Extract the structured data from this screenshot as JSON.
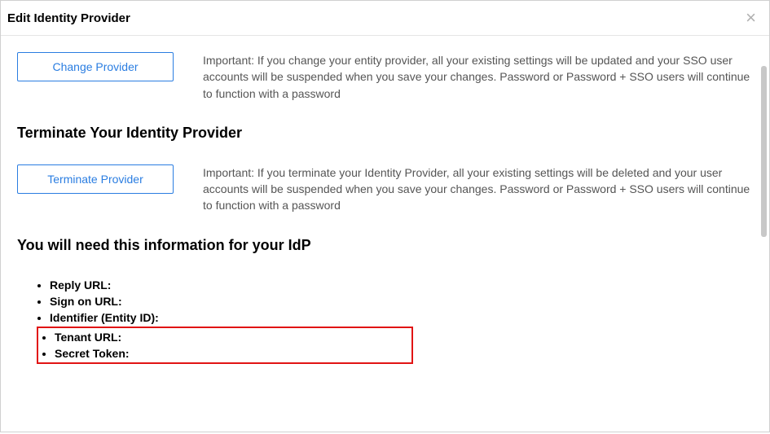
{
  "header": {
    "title": "Edit Identity Provider"
  },
  "changeProvider": {
    "buttonLabel": "Change Provider",
    "notice": "Important: If you change your entity provider, all your existing settings will be updated and your SSO user accounts will be suspended when you save your changes. Password or Password + SSO users will continue to function with a password"
  },
  "terminate": {
    "heading": "Terminate Your Identity Provider",
    "buttonLabel": "Terminate Provider",
    "notice": "Important: If you terminate your Identity Provider, all your existing settings will be deleted and your user accounts will be suspended when you save your changes. Password or Password + SSO users will continue to function with a password"
  },
  "idpInfo": {
    "heading": "You will need this information for your IdP",
    "items": {
      "replyUrl": "Reply URL:",
      "signOnUrl": "Sign on URL:",
      "identifier": "Identifier (Entity ID):",
      "tenantUrl": "Tenant URL:",
      "secretToken": "Secret Token:"
    }
  }
}
